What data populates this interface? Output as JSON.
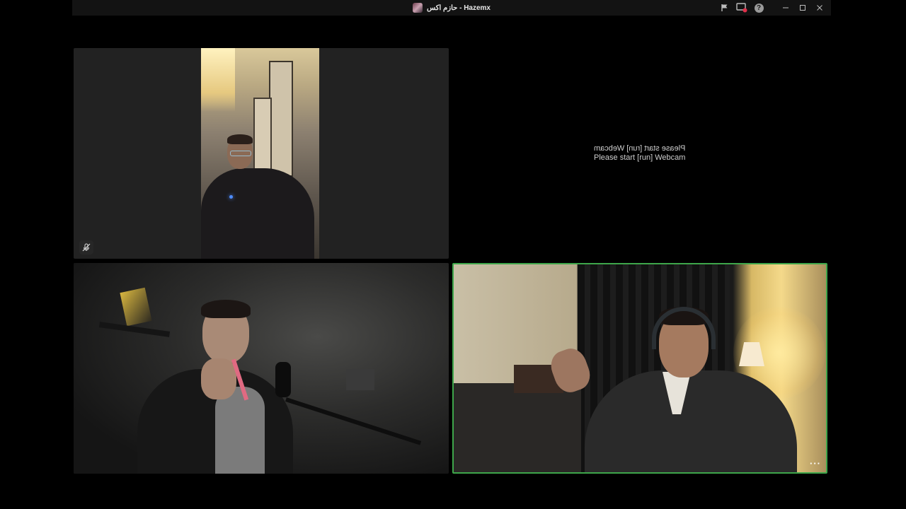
{
  "window": {
    "title": "حازم اكس - Hazemx",
    "avatar_icon": "profile-avatar",
    "controls": [
      {
        "name": "flag-icon"
      },
      {
        "name": "screen-record-icon"
      },
      {
        "name": "help-icon",
        "glyph": "?"
      },
      {
        "name": "minimize-icon"
      },
      {
        "name": "maximize-icon"
      },
      {
        "name": "close-icon"
      }
    ]
  },
  "tiles": [
    {
      "id": "participant-1",
      "type": "video-portrait",
      "muted_icon": "mic-off-icon"
    },
    {
      "id": "participant-2",
      "type": "no-video",
      "message_line1": "Please start [run] Webcam",
      "message_line2": "Please start [run] Webcam"
    },
    {
      "id": "participant-3",
      "type": "video"
    },
    {
      "id": "participant-4",
      "type": "video",
      "active_speaker": true,
      "more_label": "···"
    }
  ],
  "colors": {
    "background": "#000000",
    "titlebar": "#131313",
    "active_speaker_border": "#3ea64a"
  }
}
